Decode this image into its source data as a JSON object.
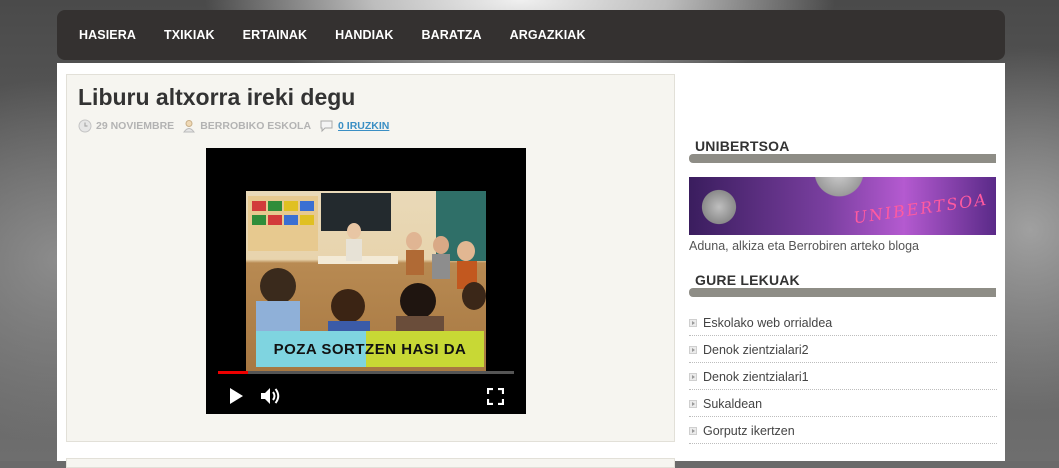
{
  "nav": {
    "items": [
      "HASIERA",
      "TXIKIAK",
      "ERTAINAK",
      "HANDIAK",
      "BARATZA",
      "ARGAZKIAK"
    ]
  },
  "post": {
    "title": "Liburu altxorra ireki degu",
    "date": "29 NOVIEMBRE",
    "author": "BERROBIKO ESKOLA",
    "comments": "0 IRUZKIN",
    "video": {
      "banner_text": "POZA SORTZEN HASI DA",
      "progress": 0.1
    }
  },
  "sidebar": {
    "widget1": {
      "title": "UNIBERTSOA",
      "banner_text": "UNIBERTSOA",
      "description": "Aduna, alkiza eta Berrobiren arteko bloga"
    },
    "widget2": {
      "title": "GURE LEKUAK",
      "links": [
        "Eskolako web orrialdea",
        "Denok zientzialari2",
        "Denok zientzialari1",
        "Sukaldean",
        "Gorputz ikertzen"
      ]
    }
  }
}
